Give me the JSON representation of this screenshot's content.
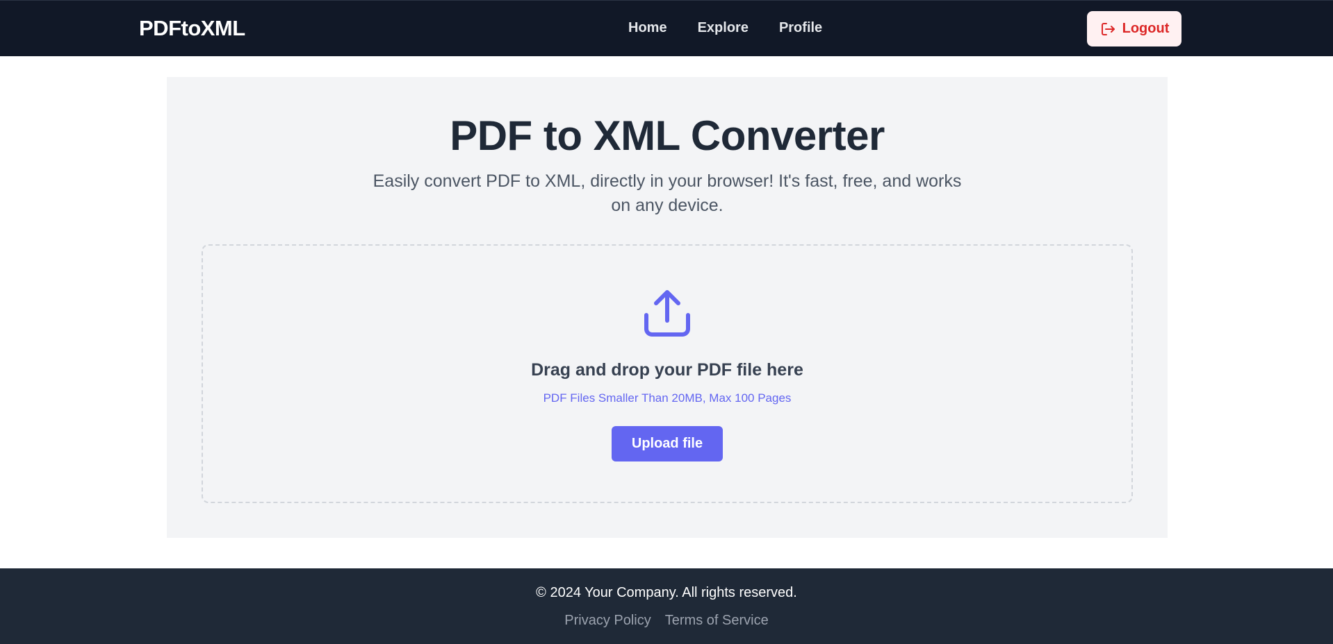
{
  "navbar": {
    "brand": "PDFtoXML",
    "links": [
      "Home",
      "Explore",
      "Profile"
    ],
    "logout_label": "Logout",
    "logout_icon": "logout-icon"
  },
  "hero": {
    "title": "PDF to XML Converter",
    "subtitle": "Easily convert PDF to XML, directly in your browser! It's fast, free, and works on any device."
  },
  "dropzone": {
    "icon": "upload-icon",
    "title": "Drag and drop your PDF file here",
    "subtitle": "PDF Files Smaller Than 20MB, Max 100 Pages",
    "button_label": "Upload file"
  },
  "footer": {
    "copyright": "© 2024 Your Company. All rights reserved.",
    "links": [
      "Privacy Policy",
      "Terms of Service"
    ]
  },
  "colors": {
    "navbar_bg": "#111827",
    "footer_bg": "#1f2937",
    "accent": "#6366f1",
    "logout_text": "#dc2626",
    "logout_bg": "#fff1f2",
    "panel_bg": "#f3f4f6"
  }
}
